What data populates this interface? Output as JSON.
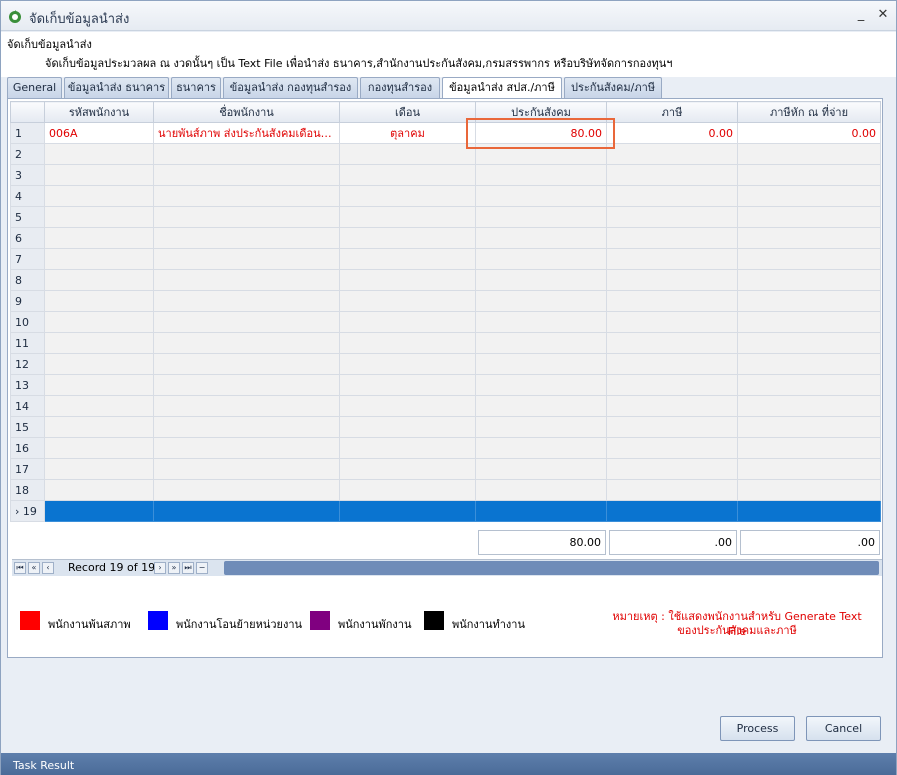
{
  "window": {
    "title": "จัดเก็บข้อมูลนำส่ง"
  },
  "header": {
    "title": "จัดเก็บข้อมูลนำส่ง",
    "description": "จัดเก็บข้อมูลประมวลผล ณ งวดนั้นๆ เป็น Text File เพื่อนำส่ง ธนาคาร,สำนักงานประกันสังคม,กรมสรรพากร หรือบริษัทจัดการกองทุนฯ"
  },
  "tabs": [
    {
      "label": "General"
    },
    {
      "label": "ข้อมูลนำส่ง ธนาคาร"
    },
    {
      "label": "ธนาคาร"
    },
    {
      "label": "ข้อมูลนำส่ง กองทุนสำรอง"
    },
    {
      "label": "กองทุนสำรอง"
    },
    {
      "label": "ข้อมูลนำส่ง สปส./ภาษี"
    },
    {
      "label": "ประกันสังคม/ภาษี"
    }
  ],
  "grid": {
    "columns": [
      "รหัสพนักงาน",
      "ชื่อพนักงาน",
      "เดือน",
      "ประกันสังคม",
      "ภาษี",
      "ภาษีหัก ณ ที่จ่าย"
    ],
    "rows": [
      {
        "num": "1",
        "code": "006A",
        "name": "นายพันส์ภาพ ส่งประกันสังคมเดือนสุ...",
        "month": "ตุลาคม",
        "sso": "80.00",
        "tax": "0.00",
        "wht": "0.00"
      },
      {
        "num": "2"
      },
      {
        "num": "3"
      },
      {
        "num": "4"
      },
      {
        "num": "5"
      },
      {
        "num": "6"
      },
      {
        "num": "7"
      },
      {
        "num": "8"
      },
      {
        "num": "9"
      },
      {
        "num": "10"
      },
      {
        "num": "11"
      },
      {
        "num": "12"
      },
      {
        "num": "13"
      },
      {
        "num": "14"
      },
      {
        "num": "15"
      },
      {
        "num": "16"
      },
      {
        "num": "17"
      },
      {
        "num": "18"
      },
      {
        "num": "19"
      }
    ],
    "totals": {
      "sso": "80.00",
      "tax": ".00",
      "wht": ".00"
    },
    "record_text": "Record 19 of 19"
  },
  "legend": [
    {
      "label": "พนักงานพ้นสภาพ",
      "color": "#ff0000"
    },
    {
      "label": "พนักงานโอนย้ายหน่วยงาน",
      "color": "#0000ff"
    },
    {
      "label": "พนักงานพักงาน",
      "color": "#800080"
    },
    {
      "label": "พนักงานทำงาน",
      "color": "#000000"
    }
  ],
  "note": {
    "line1": "หมายเหตุ : ใช้แสดงพนักงานสำหรับ Generate Text File",
    "line2": "ของประกันสังคมและภาษี"
  },
  "buttons": {
    "process": "Process",
    "cancel": "Cancel"
  },
  "status": {
    "text": "Task Result"
  }
}
